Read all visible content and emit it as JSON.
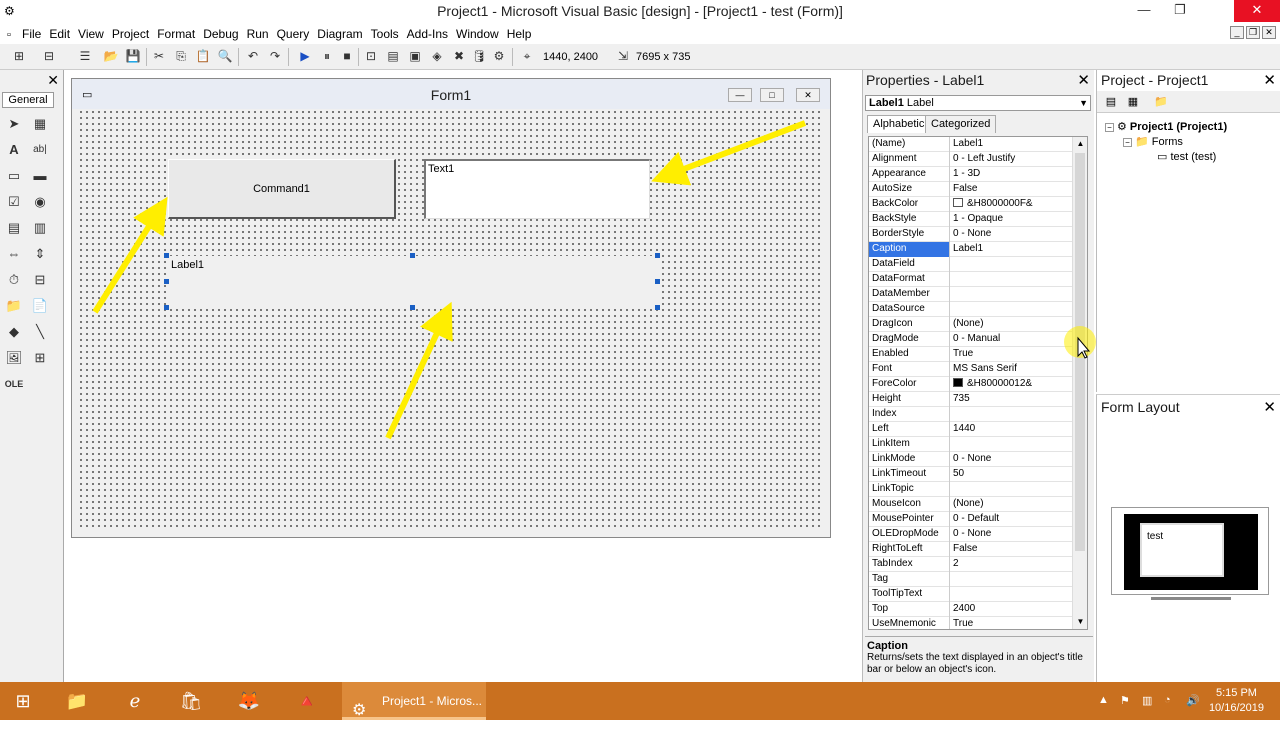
{
  "window": {
    "title": "Project1 - Microsoft Visual Basic [design] - [Project1 - test (Form)]"
  },
  "menu": [
    "File",
    "Edit",
    "View",
    "Project",
    "Format",
    "Debug",
    "Run",
    "Query",
    "Diagram",
    "Tools",
    "Add-Ins",
    "Window",
    "Help"
  ],
  "toolbar": {
    "position_readout": "1440, 2400",
    "size_readout": "7695 x 735"
  },
  "toolbox": {
    "tab_label": "General"
  },
  "form": {
    "title": "Form1",
    "command_caption": "Command1",
    "textbox_text": "Text1",
    "label_caption": "Label1"
  },
  "properties": {
    "title": "Properties - Label1",
    "object_name": "Label1",
    "object_type": "Label",
    "tab_alphabetic": "Alphabetic",
    "tab_categorized": "Categorized",
    "selected_property": "Caption",
    "rows": [
      {
        "name": "(Name)",
        "value": "Label1"
      },
      {
        "name": "Alignment",
        "value": "0 - Left Justify"
      },
      {
        "name": "Appearance",
        "value": "1 - 3D"
      },
      {
        "name": "AutoSize",
        "value": "False"
      },
      {
        "name": "BackColor",
        "value": "&H8000000F&",
        "swatch": "#ffffff"
      },
      {
        "name": "BackStyle",
        "value": "1 - Opaque"
      },
      {
        "name": "BorderStyle",
        "value": "0 - None"
      },
      {
        "name": "Caption",
        "value": "Label1"
      },
      {
        "name": "DataField",
        "value": ""
      },
      {
        "name": "DataFormat",
        "value": ""
      },
      {
        "name": "DataMember",
        "value": ""
      },
      {
        "name": "DataSource",
        "value": ""
      },
      {
        "name": "DragIcon",
        "value": "(None)"
      },
      {
        "name": "DragMode",
        "value": "0 - Manual"
      },
      {
        "name": "Enabled",
        "value": "True"
      },
      {
        "name": "Font",
        "value": "MS Sans Serif"
      },
      {
        "name": "ForeColor",
        "value": "&H80000012&",
        "swatch": "#000000"
      },
      {
        "name": "Height",
        "value": "735"
      },
      {
        "name": "Index",
        "value": ""
      },
      {
        "name": "Left",
        "value": "1440"
      },
      {
        "name": "LinkItem",
        "value": ""
      },
      {
        "name": "LinkMode",
        "value": "0 - None"
      },
      {
        "name": "LinkTimeout",
        "value": "50"
      },
      {
        "name": "LinkTopic",
        "value": ""
      },
      {
        "name": "MouseIcon",
        "value": "(None)"
      },
      {
        "name": "MousePointer",
        "value": "0 - Default"
      },
      {
        "name": "OLEDropMode",
        "value": "0 - None"
      },
      {
        "name": "RightToLeft",
        "value": "False"
      },
      {
        "name": "TabIndex",
        "value": "2"
      },
      {
        "name": "Tag",
        "value": ""
      },
      {
        "name": "ToolTipText",
        "value": ""
      },
      {
        "name": "Top",
        "value": "2400"
      },
      {
        "name": "UseMnemonic",
        "value": "True"
      }
    ],
    "desc_title": "Caption",
    "desc_text": "Returns/sets the text displayed in an object's title bar or below an object's icon."
  },
  "project": {
    "title": "Project - Project1",
    "root": "Project1 (Project1)",
    "folder": "Forms",
    "item": "test (test)"
  },
  "form_layout": {
    "title": "Form Layout",
    "form_label": "test"
  },
  "taskbar": {
    "active_task": "Project1 - Micros...",
    "time": "5:15 PM",
    "date": "10/16/2019"
  },
  "colors": {
    "taskbar": "#c9701f",
    "selection": "#3374e4",
    "arrow": "#ffee00"
  }
}
